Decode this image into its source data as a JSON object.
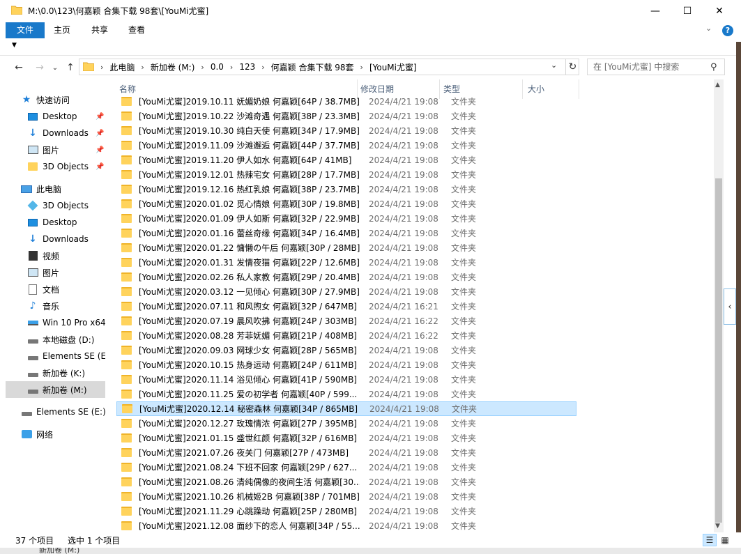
{
  "window": {
    "title": "M:\\0.0\\123\\何嘉颖 合集下载 98套\\[YouMi尤蜜]",
    "minimize": "—",
    "maximize": "☐",
    "close": "✕"
  },
  "ribbon": {
    "tabs": [
      "文件",
      "主页",
      "共享",
      "查看"
    ],
    "collapse_icon": "chevron-down-icon",
    "help_icon": "help-icon"
  },
  "address": {
    "crumbs": [
      "此电脑",
      "新加卷 (M:)",
      "0.0",
      "123",
      "何嘉颖 合集下载 98套",
      "[YouMi尤蜜]"
    ],
    "search_placeholder": "在 [YouMi尤蜜] 中搜索"
  },
  "nav": {
    "items": [
      {
        "label": "快速访问",
        "icon": "star-icon",
        "level": 0
      },
      {
        "label": "Desktop",
        "icon": "desktop-icon",
        "level": 1,
        "pinned": true
      },
      {
        "label": "Downloads",
        "icon": "downloads-icon",
        "level": 1,
        "pinned": true
      },
      {
        "label": "图片",
        "icon": "pictures-icon",
        "level": 1,
        "pinned": true
      },
      {
        "label": "3D Objects",
        "icon": "folder-icon",
        "level": 1,
        "pinned": true
      },
      {
        "label": "此电脑",
        "icon": "pc-icon",
        "level": 0
      },
      {
        "label": "3D Objects",
        "icon": "3d-objects-icon",
        "level": 1
      },
      {
        "label": "Desktop",
        "icon": "desktop-icon",
        "level": 1
      },
      {
        "label": "Downloads",
        "icon": "downloads-icon",
        "level": 1
      },
      {
        "label": "视频",
        "icon": "video-icon",
        "level": 1
      },
      {
        "label": "图片",
        "icon": "pictures-icon",
        "level": 1
      },
      {
        "label": "文档",
        "icon": "documents-icon",
        "level": 1
      },
      {
        "label": "音乐",
        "icon": "music-icon",
        "level": 1
      },
      {
        "label": "Win 10 Pro x64",
        "icon": "windows-drive-icon",
        "level": 1
      },
      {
        "label": "本地磁盘 (D:)",
        "icon": "drive-icon",
        "level": 1
      },
      {
        "label": "Elements SE (E:",
        "icon": "drive-icon",
        "level": 1
      },
      {
        "label": "新加卷 (K:)",
        "icon": "drive-icon",
        "level": 1
      },
      {
        "label": "新加卷 (M:)",
        "icon": "drive-icon",
        "level": 1,
        "selected": true
      },
      {
        "label": "Elements SE (E:)",
        "icon": "drive-icon",
        "level": 0
      },
      {
        "label": "网络",
        "icon": "network-icon",
        "level": 0
      }
    ]
  },
  "columns": {
    "name": "名称",
    "date": "修改日期",
    "type": "类型",
    "size": "大小"
  },
  "files": [
    {
      "name": "[YouMi尤蜜]2019.10.11 妩媚奶娘 何嘉颖[64P / 38.7MB]",
      "date": "2024/4/21 19:08",
      "type": "文件夹"
    },
    {
      "name": "[YouMi尤蜜]2019.10.22 沙滩奇遇 何嘉颖[38P / 23.3MB]",
      "date": "2024/4/21 19:08",
      "type": "文件夹"
    },
    {
      "name": "[YouMi尤蜜]2019.10.30 纯白天使 何嘉颖[34P / 17.9MB]",
      "date": "2024/4/21 19:08",
      "type": "文件夹"
    },
    {
      "name": "[YouMi尤蜜]2019.11.09 沙滩邂逅 何嘉颖[44P / 37.7MB]",
      "date": "2024/4/21 19:08",
      "type": "文件夹"
    },
    {
      "name": "[YouMi尤蜜]2019.11.20 伊人如水 何嘉颖[64P / 41MB]",
      "date": "2024/4/21 19:08",
      "type": "文件夹"
    },
    {
      "name": "[YouMi尤蜜]2019.12.01 热辣宅女 何嘉颖[28P / 17.7MB]",
      "date": "2024/4/21 19:08",
      "type": "文件夹"
    },
    {
      "name": "[YouMi尤蜜]2019.12.16 热红乳娘 何嘉颖[38P / 23.7MB]",
      "date": "2024/4/21 19:08",
      "type": "文件夹"
    },
    {
      "name": "[YouMi尤蜜]2020.01.02 觅心情娘 何嘉颖[30P / 19.8MB]",
      "date": "2024/4/21 19:08",
      "type": "文件夹"
    },
    {
      "name": "[YouMi尤蜜]2020.01.09 伊人如斯 何嘉颖[32P / 22.9MB]",
      "date": "2024/4/21 19:08",
      "type": "文件夹"
    },
    {
      "name": "[YouMi尤蜜]2020.01.16 蕾丝奇缘 何嘉颖[34P / 16.4MB]",
      "date": "2024/4/21 19:08",
      "type": "文件夹"
    },
    {
      "name": "[YouMi尤蜜]2020.01.22 慵懒の午后 何嘉颖[30P / 28MB]",
      "date": "2024/4/21 19:08",
      "type": "文件夹"
    },
    {
      "name": "[YouMi尤蜜]2020.01.31 发情夜猫 何嘉颖[22P / 12.6MB]",
      "date": "2024/4/21 19:08",
      "type": "文件夹"
    },
    {
      "name": "[YouMi尤蜜]2020.02.26 私人家教 何嘉颖[29P / 20.4MB]",
      "date": "2024/4/21 19:08",
      "type": "文件夹"
    },
    {
      "name": "[YouMi尤蜜]2020.03.12 一见倾心 何嘉颖[30P / 27.9MB]",
      "date": "2024/4/21 19:08",
      "type": "文件夹"
    },
    {
      "name": "[YouMi尤蜜]2020.07.11 和风煦女 何嘉颖[32P / 647MB]",
      "date": "2024/4/21 16:21",
      "type": "文件夹"
    },
    {
      "name": "[YouMi尤蜜]2020.07.19 晨风吹拂 何嘉颖[24P / 303MB]",
      "date": "2024/4/21 16:22",
      "type": "文件夹"
    },
    {
      "name": "[YouMi尤蜜]2020.08.28 芳菲妩媚 何嘉颖[21P / 408MB]",
      "date": "2024/4/21 16:22",
      "type": "文件夹"
    },
    {
      "name": "[YouMi尤蜜]2020.09.03 网球少女 何嘉颖[28P / 565MB]",
      "date": "2024/4/21 19:08",
      "type": "文件夹"
    },
    {
      "name": "[YouMi尤蜜]2020.10.15 热身运动 何嘉颖[24P / 611MB]",
      "date": "2024/4/21 19:08",
      "type": "文件夹"
    },
    {
      "name": "[YouMi尤蜜]2020.11.14 浴见倾心 何嘉颖[41P / 590MB]",
      "date": "2024/4/21 19:08",
      "type": "文件夹"
    },
    {
      "name": "[YouMi尤蜜]2020.11.25 爱の初学者 何嘉颖[40P / 599...",
      "date": "2024/4/21 19:08",
      "type": "文件夹"
    },
    {
      "name": "[YouMi尤蜜]2020.12.14 秘密森林 何嘉颖[34P / 865MB]",
      "date": "2024/4/21 19:08",
      "type": "文件夹",
      "selected": true
    },
    {
      "name": "[YouMi尤蜜]2020.12.27 玫瑰情浓 何嘉颖[27P / 395MB]",
      "date": "2024/4/21 19:08",
      "type": "文件夹"
    },
    {
      "name": "[YouMi尤蜜]2021.01.15 盛世红颜 何嘉颖[32P / 616MB]",
      "date": "2024/4/21 19:08",
      "type": "文件夹"
    },
    {
      "name": "[YouMi尤蜜]2021.07.26 夜关门 何嘉颖[27P / 473MB]",
      "date": "2024/4/21 19:08",
      "type": "文件夹"
    },
    {
      "name": "[YouMi尤蜜]2021.08.24 下班不回家 何嘉颖[29P / 627...",
      "date": "2024/4/21 19:08",
      "type": "文件夹"
    },
    {
      "name": "[YouMi尤蜜]2021.08.26 清纯偶像的夜间生活 何嘉颖[30...",
      "date": "2024/4/21 19:08",
      "type": "文件夹"
    },
    {
      "name": "[YouMi尤蜜]2021.10.26 机械姬2B 何嘉颖[38P / 701MB]",
      "date": "2024/4/21 19:08",
      "type": "文件夹"
    },
    {
      "name": "[YouMi尤蜜]2021.11.29 心跳躁动 何嘉颖[25P / 280MB]",
      "date": "2024/4/21 19:08",
      "type": "文件夹"
    },
    {
      "name": "[YouMi尤蜜]2021.12.08 面纱下的恋人 何嘉颖[34P / 55...",
      "date": "2024/4/21 19:08",
      "type": "文件夹"
    }
  ],
  "status": {
    "item_count": "37 个项目",
    "selection": "选中 1 个项目"
  },
  "taskbar_peek": "新加卷 (M:)",
  "colors": {
    "accent": "#1979ca",
    "selection_bg": "#cce8ff",
    "selection_border": "#99d1ff",
    "folder": "#ffd35c"
  }
}
